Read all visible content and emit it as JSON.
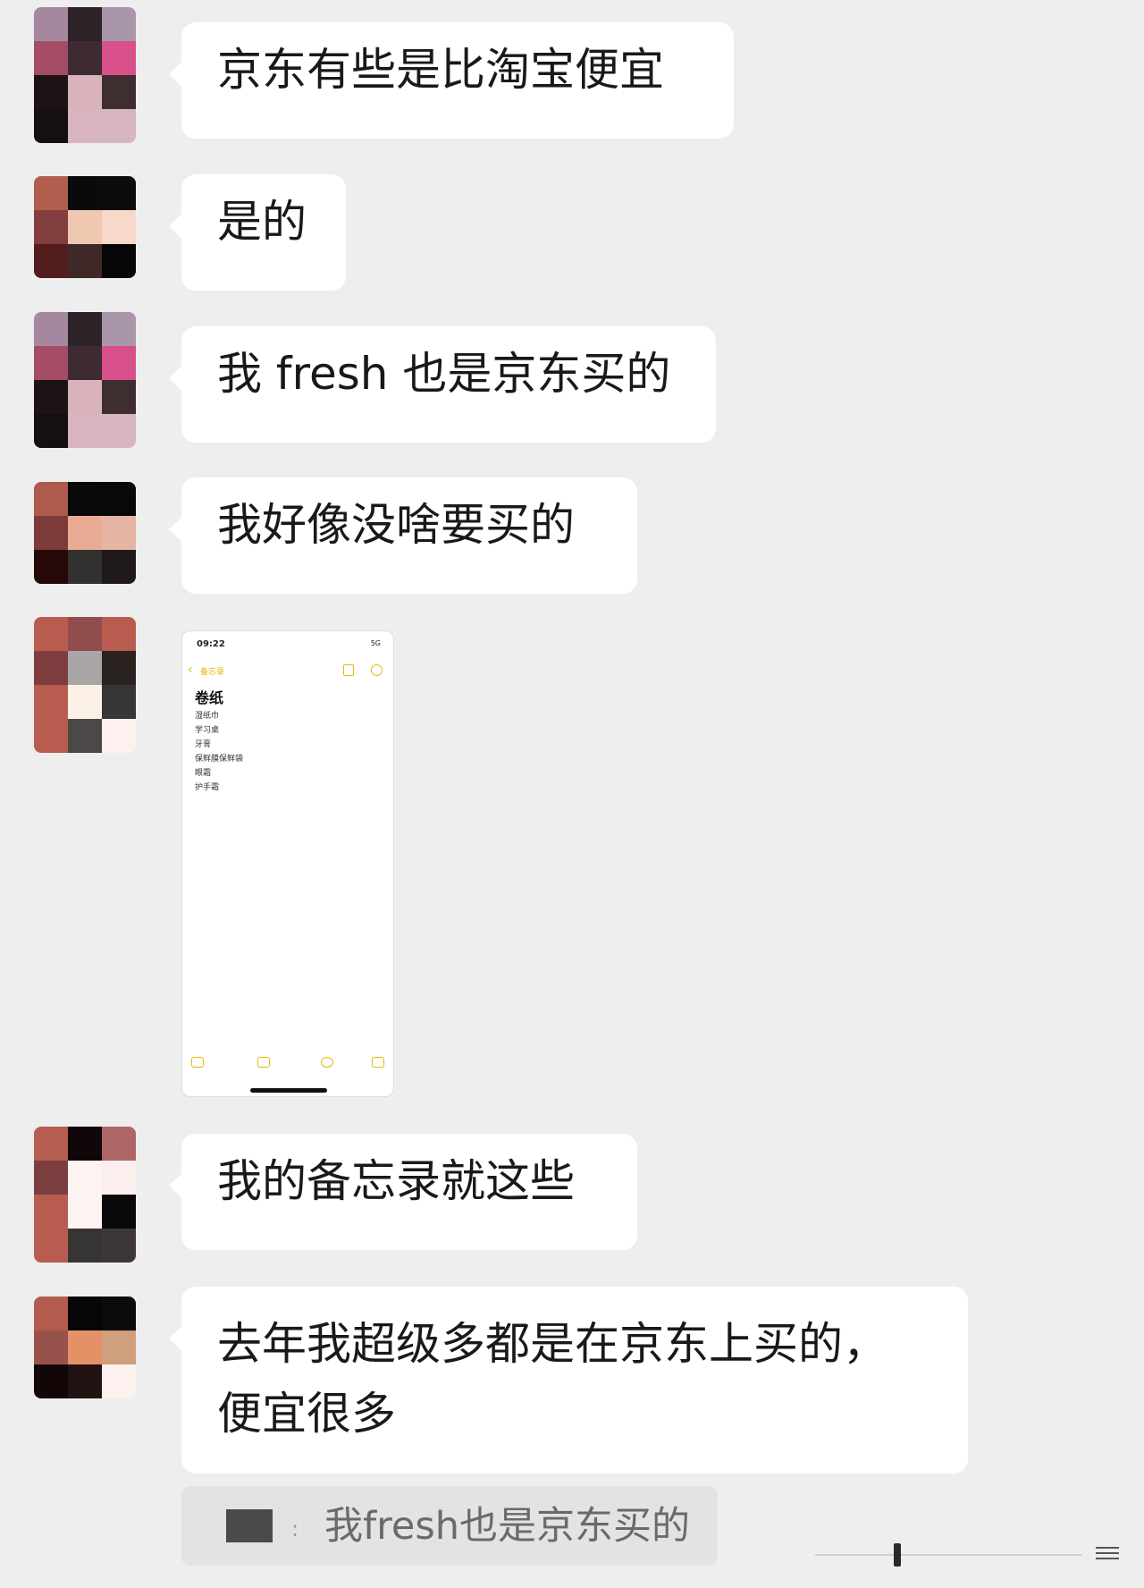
{
  "messages": [
    {
      "type": "text",
      "text": "京东有些是比淘宝便宜"
    },
    {
      "type": "text",
      "text": "是的"
    },
    {
      "type": "text",
      "text": "我 fresh 也是京东买的"
    },
    {
      "type": "text",
      "text": "我好像没啥要买的"
    },
    {
      "type": "image",
      "screenshot": {
        "time": "09:22",
        "signal": "5G",
        "back_label": "备忘录",
        "note_title": "卷纸",
        "note_lines": [
          "湿纸巾",
          "学习桌",
          "牙膏",
          "保鲜膜保鲜袋",
          "眼霜",
          "护手霜"
        ]
      }
    },
    {
      "type": "text",
      "text": "我的备忘录就这些"
    },
    {
      "type": "text",
      "lines": [
        "去年我超级多都是在京东上买的，",
        "便宜很多"
      ]
    }
  ],
  "quote": {
    "separator": ":",
    "text": "我fresh也是京东买的"
  },
  "avatars": {
    "a": [
      "#a5889f",
      "#2d2328",
      "#a996aa",
      "#a54c66",
      "#3d2a33",
      "#d8508a",
      "#1d1216",
      "#d8b3bb",
      "#3f2e30",
      "#141012",
      "#d8b5c1",
      "#d8b6bf"
    ],
    "b": [
      "#b05e4e",
      "#0a0a0a",
      "#0c0c0c",
      "#823d3e",
      "#f0c8b2",
      "#f8d8c8",
      "#521d1c",
      "#3e2928",
      "#060606"
    ],
    "c": [
      "#ae5a4d",
      "#090909",
      "#080808",
      "#7c3a38",
      "#eaab95",
      "#e6b4a2",
      "#270808",
      "#333030",
      "#1f1919"
    ],
    "d": [
      "#b85c4f",
      "#914c4e",
      "#b85c4f",
      "#7e3e3f",
      "#a9a6a5",
      "#2a221f",
      "#b85c4f",
      "#fcf1e7",
      "#373535",
      "#b85c4f",
      "#4c4848",
      "#fcf1ee"
    ],
    "e": [
      "#b65e51",
      "#120708",
      "#ae6566",
      "#7d3e3f",
      "#fdf3f0",
      "#fbf0ee",
      "#b85c4f",
      "#fdf3f0",
      "#090909",
      "#b85c4f",
      "#373434",
      "#3d3636"
    ],
    "f": [
      "#b35b4d",
      "#060606",
      "#0c0c0c",
      "#98524c",
      "#e69068",
      "#cf9f7e",
      "#120606",
      "#231212",
      "#fcf1ee"
    ]
  }
}
